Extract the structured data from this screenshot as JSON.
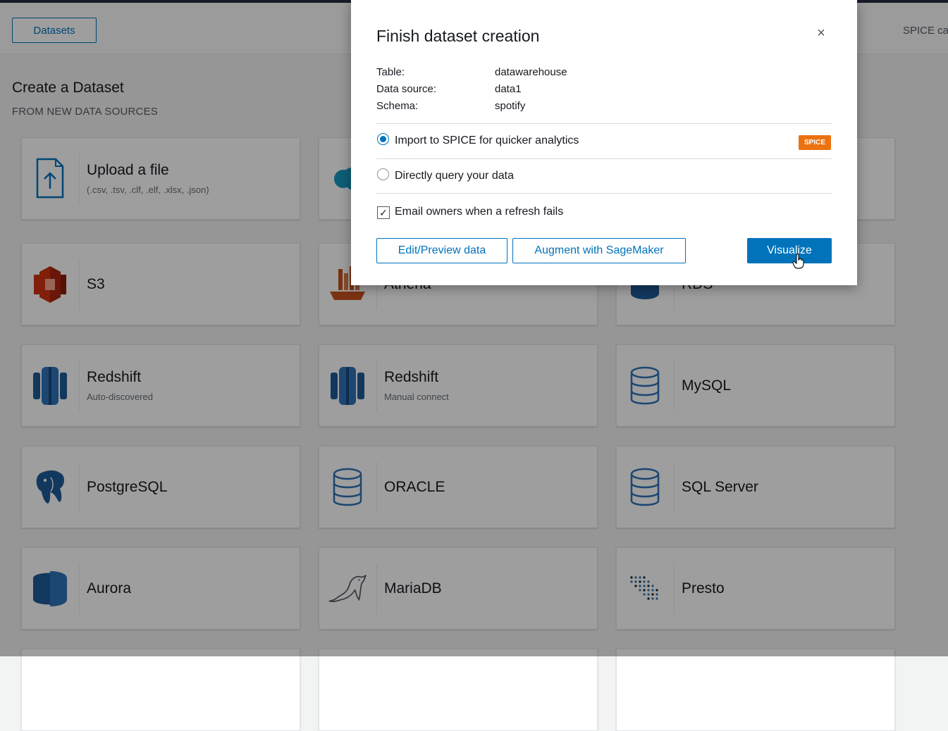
{
  "header": {
    "datasets_button": "Datasets",
    "spice_capacity_label": "SPICE ca"
  },
  "page": {
    "title": "Create a Dataset",
    "subtitle": "FROM NEW DATA SOURCES"
  },
  "sources": [
    {
      "title": "Upload a file",
      "subtitle": "(.csv, .tsv, .clf, .elf, .xlsx, .json)",
      "icon": "upload-file-icon"
    },
    {
      "title": "",
      "subtitle": "",
      "icon": "salesforce-icon"
    },
    {
      "title": "",
      "subtitle": "",
      "icon": ""
    },
    {
      "title": "S3",
      "subtitle": "",
      "icon": "s3-icon"
    },
    {
      "title": "Athena",
      "subtitle": "",
      "icon": "athena-icon"
    },
    {
      "title": "RDS",
      "subtitle": "",
      "icon": "rds-icon"
    },
    {
      "title": "Redshift",
      "subtitle": "Auto-discovered",
      "icon": "redshift-icon"
    },
    {
      "title": "Redshift",
      "subtitle": "Manual connect",
      "icon": "redshift-icon"
    },
    {
      "title": "MySQL",
      "subtitle": "",
      "icon": "database-icon"
    },
    {
      "title": "PostgreSQL",
      "subtitle": "",
      "icon": "postgresql-elephant-icon"
    },
    {
      "title": "ORACLE",
      "subtitle": "",
      "icon": "database-icon"
    },
    {
      "title": "SQL Server",
      "subtitle": "",
      "icon": "database-icon"
    },
    {
      "title": "Aurora",
      "subtitle": "",
      "icon": "aurora-icon"
    },
    {
      "title": "MariaDB",
      "subtitle": "",
      "icon": "mariadb-seal-icon"
    },
    {
      "title": "Presto",
      "subtitle": "",
      "icon": "presto-icon"
    }
  ],
  "modal": {
    "title": "Finish dataset creation",
    "close": "×",
    "info": [
      {
        "key": "Table:",
        "value": "datawarehouse"
      },
      {
        "key": "Data source:",
        "value": "data1"
      },
      {
        "key": "Schema:",
        "value": "spotify"
      }
    ],
    "option_spice": "Import to SPICE for quicker analytics",
    "spice_badge": "SPICE",
    "option_direct": "Directly query your data",
    "selected_option": "spice",
    "email_checkbox_label": "Email owners when a refresh fails",
    "email_checked": true,
    "checkmark": "✓",
    "buttons": {
      "edit_preview": "Edit/Preview data",
      "augment": "Augment with SageMaker",
      "visualize": "Visualize"
    }
  },
  "colors": {
    "accent": "#0073bb",
    "spice_badge": "#ec7211",
    "aws_orange_red": "#d13212",
    "redshift_blue": "#205b98"
  }
}
